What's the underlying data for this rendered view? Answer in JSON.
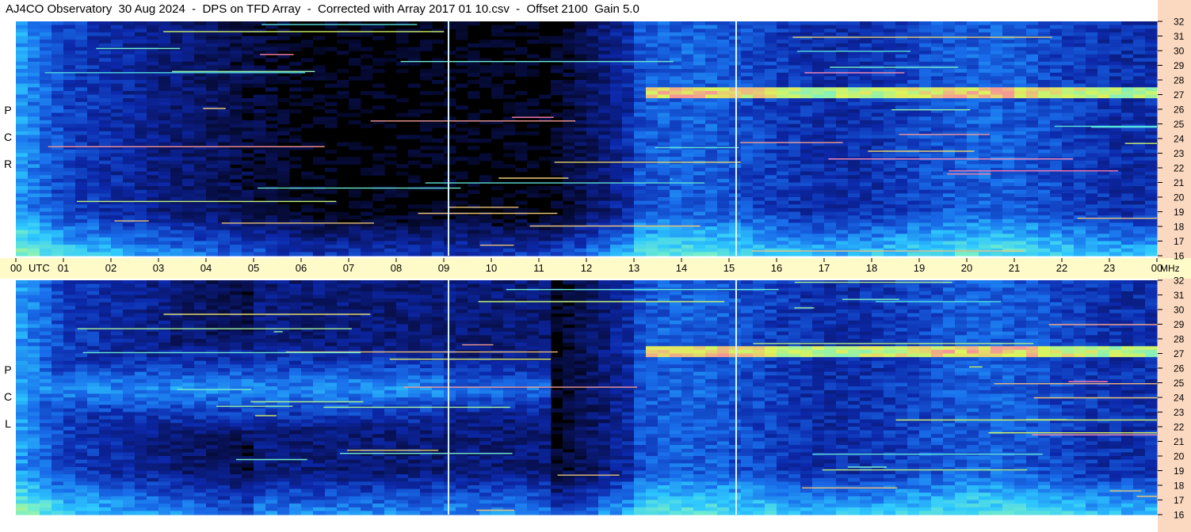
{
  "title": "AJ4CO Observatory  30 Aug 2024  -  DPS on TFD Array  -  Corrected with Array 2017 01 10.csv  -  Offset 2100  Gain 5.0",
  "panels": [
    {
      "polarization": [
        "R",
        "C",
        "P"
      ]
    },
    {
      "polarization": [
        "L",
        "C",
        "P"
      ]
    }
  ],
  "colors": {
    "background_dark": "#000000",
    "deep_blue": "#0a1a8c",
    "cyan": "#2fd0ff",
    "yellow_green": "#c8f060",
    "axis_band": "#fffbc9",
    "right_frame": "#fbd9c0"
  },
  "chart_data": {
    "type": "heatmap",
    "title": "AJ4CO Observatory  30 Aug 2024  -  DPS on TFD Array  -  Corrected with Array 2017 01 10.csv  -  Offset 2100  Gain 5.0",
    "xlabel": "UTC",
    "ylabel": "MHz",
    "x_ticks": [
      "00",
      "01",
      "02",
      "03",
      "04",
      "05",
      "06",
      "07",
      "08",
      "09",
      "10",
      "11",
      "12",
      "13",
      "14",
      "15",
      "16",
      "17",
      "18",
      "19",
      "20",
      "21",
      "22",
      "23",
      "00"
    ],
    "y_ticks": [
      16,
      17,
      18,
      19,
      20,
      21,
      22,
      23,
      24,
      25,
      26,
      27,
      28,
      29,
      30,
      31,
      32
    ],
    "xlim": [
      0,
      24
    ],
    "ylim": [
      16,
      32
    ],
    "vertical_markers_utc": [
      9.1,
      15.15
    ],
    "panels": [
      "RCP",
      "LCP"
    ],
    "notes_visible": "dynamic spectrogram, dark night gap ~06-11 UTC, bright band near 27 MHz during 13-24 UTC"
  }
}
